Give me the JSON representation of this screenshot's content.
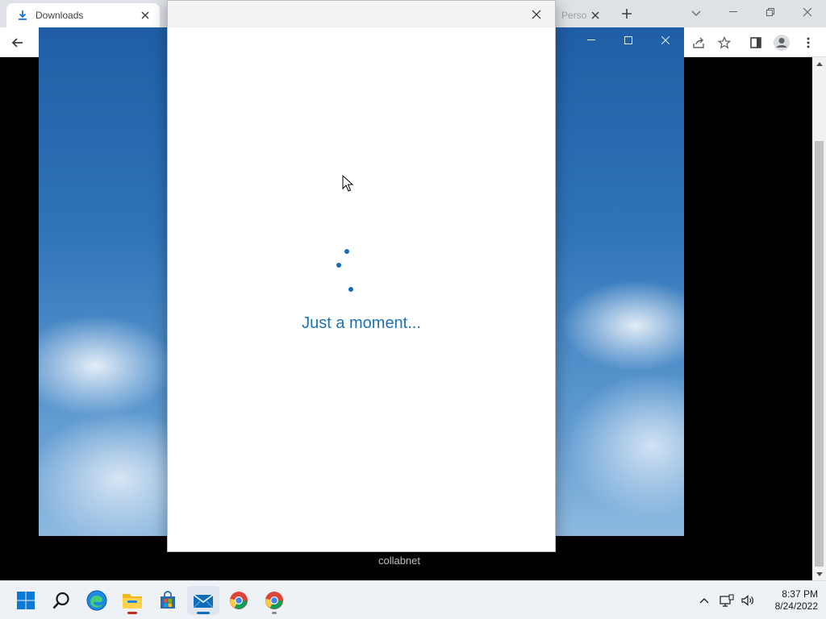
{
  "browser": {
    "active_tab": {
      "title": "Downloads",
      "icon": "download-icon"
    },
    "partial_tab": {
      "title": "Perso"
    },
    "icons": {
      "back": "arrow-left-icon",
      "share": "share-icon",
      "bookmark": "star-icon",
      "side_panel": "side-panel-icon",
      "profile": "profile-icon",
      "menu": "kebab-menu-icon"
    }
  },
  "page": {
    "caption": "collabnet"
  },
  "dialog": {
    "message": "Just a moment..."
  },
  "taskbar": {
    "apps": [
      "windows-start",
      "search",
      "edge",
      "file-explorer",
      "microsoft-store",
      "mail",
      "chrome",
      "chrome"
    ],
    "clock": {
      "time": "8:37 PM",
      "date": "8/24/2022"
    }
  },
  "colors": {
    "accent": "#0f6cbd",
    "message": "#1a73b8",
    "tab_strip": "#dee1e6",
    "taskbar": "#eef1f6"
  }
}
